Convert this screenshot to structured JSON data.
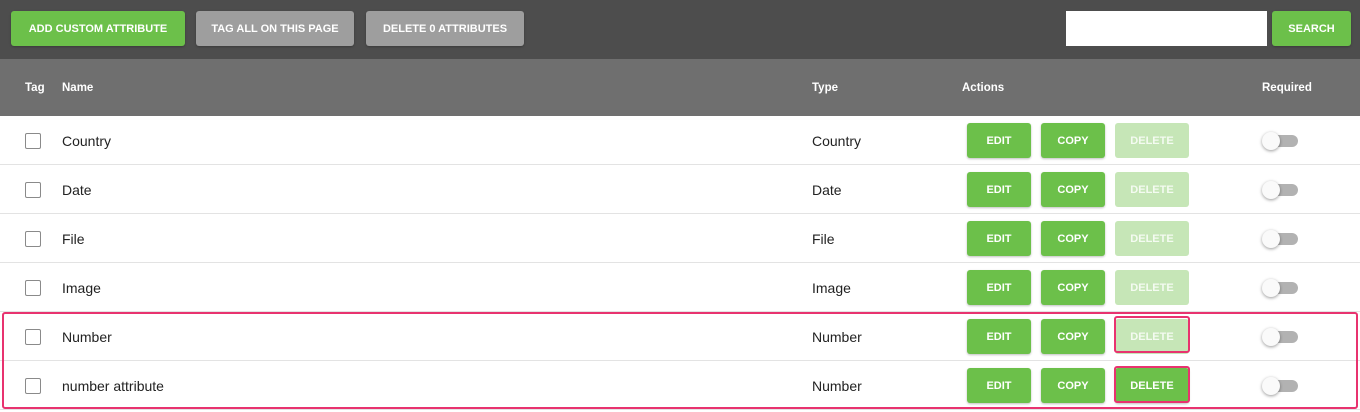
{
  "toolbar": {
    "add_label": "ADD CUSTOM ATTRIBUTE",
    "tag_all_label": "TAG ALL ON THIS PAGE",
    "delete_attrs_label": "DELETE 0 ATTRIBUTES",
    "search_value": "",
    "search_label": "SEARCH"
  },
  "header": {
    "tag": "Tag",
    "name": "Name",
    "type": "Type",
    "actions": "Actions",
    "required": "Required"
  },
  "actions": {
    "edit": "EDIT",
    "copy": "COPY",
    "delete": "DELETE"
  },
  "rows": [
    {
      "name": "Country",
      "type": "Country",
      "delete_enabled": false,
      "required": false
    },
    {
      "name": "Date",
      "type": "Date",
      "delete_enabled": false,
      "required": false
    },
    {
      "name": "File",
      "type": "File",
      "delete_enabled": false,
      "required": false
    },
    {
      "name": "Image",
      "type": "Image",
      "delete_enabled": false,
      "required": false
    },
    {
      "name": "Number",
      "type": "Number",
      "delete_enabled": false,
      "required": false
    },
    {
      "name": "number attribute",
      "type": "Number",
      "delete_enabled": true,
      "required": false
    }
  ],
  "colors": {
    "accent_green": "#6cc04a",
    "disabled_green": "#c6e6b7",
    "highlight_pink": "#e8336f",
    "toolbar_bg": "#4d4d4d",
    "header_bg": "#6f6f6f"
  }
}
